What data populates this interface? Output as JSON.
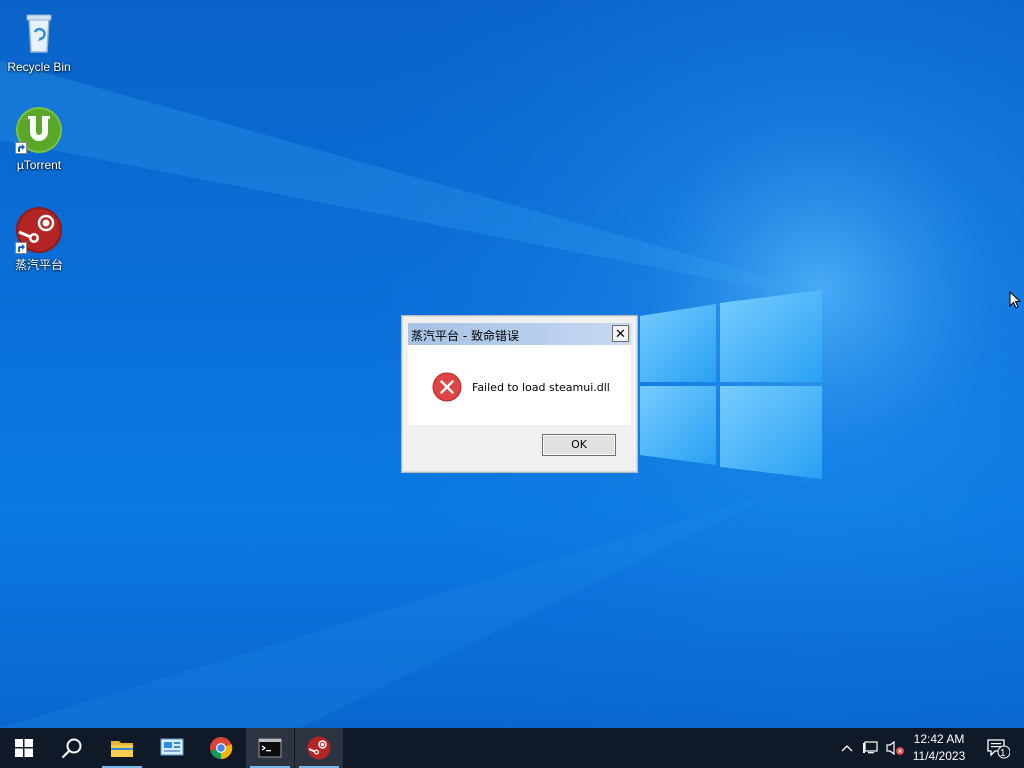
{
  "desktop": {
    "icons": [
      {
        "label": "Recycle Bin",
        "icon": "recycle-bin-icon"
      },
      {
        "label": "µTorrent",
        "icon": "utorrent-icon"
      },
      {
        "label": "蒸汽平台",
        "icon": "steam-icon"
      }
    ]
  },
  "dialog": {
    "title": "蒸汽平台 - 致命错误",
    "close_label": "✕",
    "message": "Failed to load steamui.dll",
    "ok_label": "OK",
    "icon": "error-icon"
  },
  "taskbar": {
    "items": [
      {
        "name": "start",
        "icon": "windows-start-icon"
      },
      {
        "name": "search",
        "icon": "search-icon"
      },
      {
        "name": "file-explorer",
        "icon": "folder-icon"
      },
      {
        "name": "control-panel",
        "icon": "control-panel-icon"
      },
      {
        "name": "chrome",
        "icon": "chrome-icon"
      },
      {
        "name": "command-prompt",
        "icon": "cmd-icon"
      },
      {
        "name": "steam",
        "icon": "steam-icon"
      }
    ],
    "tray": {
      "time": "12:42 AM",
      "date": "11/4/2023",
      "notification_count": "1"
    }
  },
  "colors": {
    "desktop_blue": "#0a6fd8",
    "taskbar": "#101927",
    "error_red": "#e04343",
    "running_indicator": "#76b9ed"
  }
}
